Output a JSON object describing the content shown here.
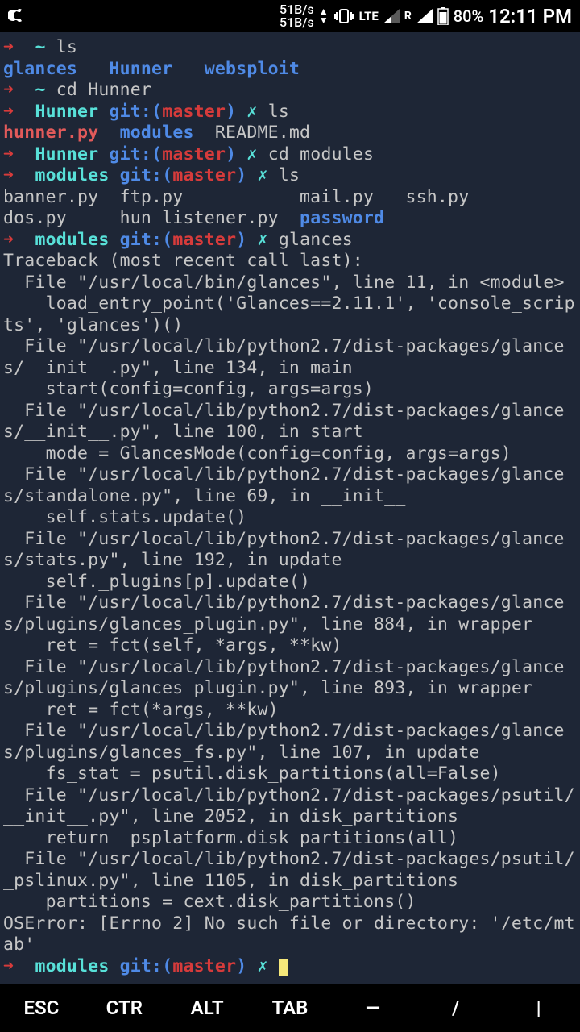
{
  "statusbar": {
    "speed_up": "51B/s",
    "speed_down": "51B/s",
    "lte": "LTE",
    "r": "R",
    "battery": "80%",
    "time": "12:11 PM"
  },
  "keys": {
    "esc": "ESC",
    "ctr": "CTR",
    "alt": "ALT",
    "tab": "TAB",
    "dash": "—",
    "slash": "/",
    "pipe": "|"
  },
  "term": {
    "ls1_cmd": "ls",
    "ls1_out_glances": "glances",
    "ls1_out_hunner": "Hunner",
    "ls1_out_websploit": "websploit",
    "cd1": "cd Hunner",
    "git_label": "git:(",
    "git_branch": "master",
    "git_close": ")",
    "prompt_dir_hunner": "Hunner",
    "prompt_dir_modules": "modules",
    "cross": "✗",
    "ls2_cmd": "ls",
    "ls2_hunnerpy": "hunner.py",
    "ls2_modules": "modules",
    "ls2_readme": "README.md",
    "cd2": "cd modules",
    "ls3_cmd": "ls",
    "ls3_line1": "banner.py  ftp.py           mail.py   ssh.py",
    "ls3_line2a": "dos.py     hun_listener.py  ",
    "ls3_password": "password",
    "glances_cmd": "glances",
    "tb0": "Traceback (most recent call last):",
    "tb1": "  File \"/usr/local/bin/glances\", line 11, in <module>",
    "tb2": "    load_entry_point('Glances==2.11.1', 'console_scripts', 'glances')()",
    "tb3": "  File \"/usr/local/lib/python2.7/dist-packages/glances/__init__.py\", line 134, in main",
    "tb4": "    start(config=config, args=args)",
    "tb5": "  File \"/usr/local/lib/python2.7/dist-packages/glances/__init__.py\", line 100, in start",
    "tb6": "    mode = GlancesMode(config=config, args=args)",
    "tb7": "  File \"/usr/local/lib/python2.7/dist-packages/glances/standalone.py\", line 69, in __init__",
    "tb8": "    self.stats.update()",
    "tb9": "  File \"/usr/local/lib/python2.7/dist-packages/glances/stats.py\", line 192, in update",
    "tb10": "    self._plugins[p].update()",
    "tb11": "  File \"/usr/local/lib/python2.7/dist-packages/glances/plugins/glances_plugin.py\", line 884, in wrapper",
    "tb12": "    ret = fct(self, *args, **kw)",
    "tb13": "  File \"/usr/local/lib/python2.7/dist-packages/glances/plugins/glances_plugin.py\", line 893, in wrapper",
    "tb14": "    ret = fct(*args, **kw)",
    "tb15": "  File \"/usr/local/lib/python2.7/dist-packages/glances/plugins/glances_fs.py\", line 107, in update",
    "tb16": "    fs_stat = psutil.disk_partitions(all=False)",
    "tb17": "  File \"/usr/local/lib/python2.7/dist-packages/psutil/__init__.py\", line 2052, in disk_partitions",
    "tb18": "    return _psplatform.disk_partitions(all)",
    "tb19": "  File \"/usr/local/lib/python2.7/dist-packages/psutil/_pslinux.py\", line 1105, in disk_partitions",
    "tb20": "    partitions = cext.disk_partitions()",
    "tb21": "OSError: [Errno 2] No such file or directory: '/etc/mtab'"
  }
}
